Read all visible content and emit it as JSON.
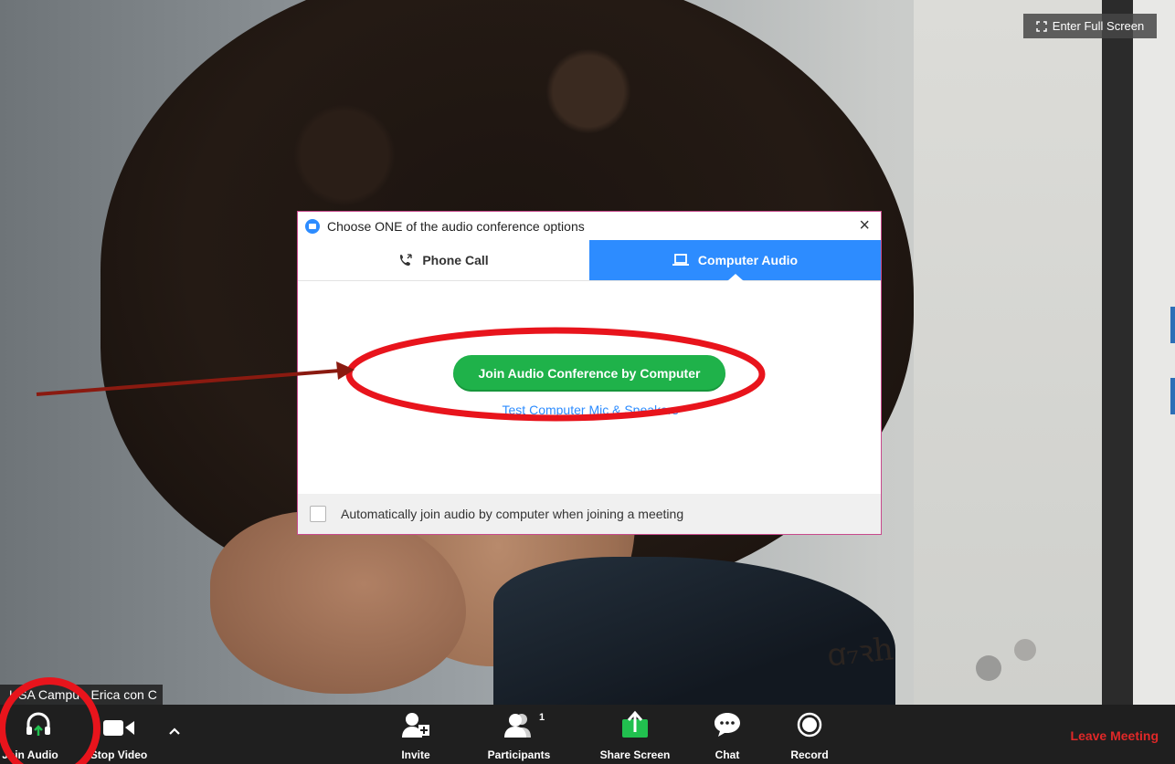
{
  "video": {
    "fullscreen_label": "Enter Full Screen",
    "participant_name": "USA Campu - Erica con C"
  },
  "dialog": {
    "title": "Choose ONE of the audio conference options",
    "tabs": [
      {
        "label": "Phone Call",
        "icon": "phone-icon",
        "active": false
      },
      {
        "label": "Computer Audio",
        "icon": "laptop-icon",
        "active": true
      }
    ],
    "join_button": "Join Audio Conference by Computer",
    "test_link": "Test Computer Mic & Speakers",
    "auto_join_label": "Automatically join audio by computer when joining a meeting",
    "auto_join_checked": false
  },
  "toolbar": {
    "join_audio": "Join Audio",
    "stop_video": "Stop Video",
    "invite": "Invite",
    "participants": "Participants",
    "participants_count": "1",
    "share_screen": "Share Screen",
    "chat": "Chat",
    "record": "Record",
    "leave": "Leave Meeting"
  },
  "colors": {
    "accent": "#2d8cff",
    "join_green": "#1fb24a",
    "leave_red": "#e02828",
    "annotation_red": "#e8141c"
  }
}
